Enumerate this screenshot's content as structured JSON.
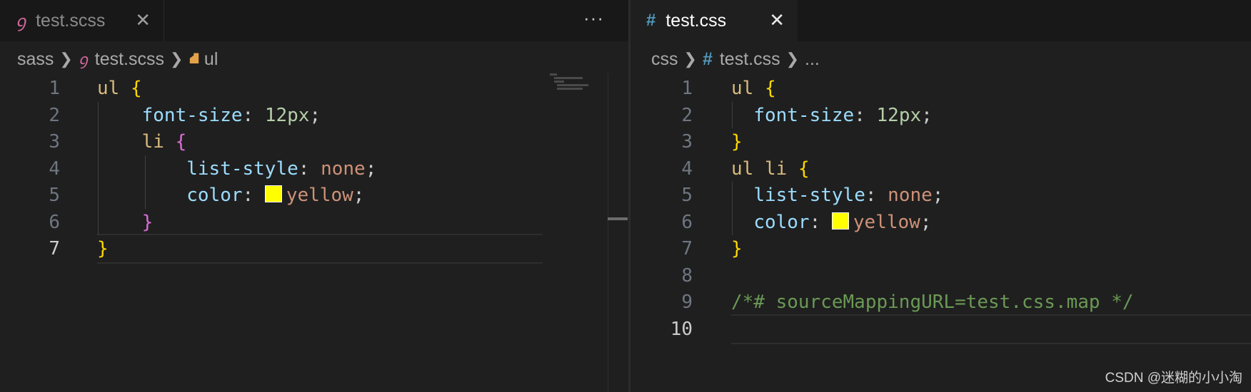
{
  "left_editor": {
    "tab": {
      "icon": "sass-icon",
      "label": "test.scss",
      "close": "✕",
      "more": "···"
    },
    "breadcrumb": {
      "folder": "sass",
      "file": "test.scss",
      "symbol": "ul"
    },
    "lines": [
      {
        "n": "1",
        "tokens": [
          [
            "sel",
            "ul"
          ],
          [
            "pun",
            " "
          ],
          [
            "br1",
            "{"
          ]
        ]
      },
      {
        "n": "2",
        "tokens": [
          [
            "pun",
            "    "
          ],
          [
            "prop",
            "font-size"
          ],
          [
            "pun",
            ": "
          ],
          [
            "num",
            "12px"
          ],
          [
            "pun",
            ";"
          ]
        ]
      },
      {
        "n": "3",
        "tokens": [
          [
            "pun",
            "    "
          ],
          [
            "sel",
            "li"
          ],
          [
            "pun",
            " "
          ],
          [
            "br2",
            "{"
          ]
        ]
      },
      {
        "n": "4",
        "tokens": [
          [
            "pun",
            "        "
          ],
          [
            "prop",
            "list-style"
          ],
          [
            "pun",
            ": "
          ],
          [
            "val",
            "none"
          ],
          [
            "pun",
            ";"
          ]
        ]
      },
      {
        "n": "5",
        "tokens": [
          [
            "pun",
            "        "
          ],
          [
            "prop",
            "color"
          ],
          [
            "pun",
            ": "
          ],
          [
            "swatch",
            ""
          ],
          [
            "val",
            "yellow"
          ],
          [
            "pun",
            ";"
          ]
        ]
      },
      {
        "n": "6",
        "tokens": [
          [
            "pun",
            "    "
          ],
          [
            "br2",
            "}"
          ]
        ]
      },
      {
        "n": "7",
        "tokens": [
          [
            "br1",
            "}"
          ]
        ],
        "active": true
      }
    ]
  },
  "right_editor": {
    "tab": {
      "icon": "css-icon",
      "label": "test.css",
      "close": "✕"
    },
    "breadcrumb": {
      "folder": "css",
      "file": "test.css",
      "symbol": "..."
    },
    "lines": [
      {
        "n": "1",
        "tokens": [
          [
            "sel",
            "ul"
          ],
          [
            "pun",
            " "
          ],
          [
            "br1",
            "{"
          ]
        ]
      },
      {
        "n": "2",
        "tokens": [
          [
            "pun",
            "  "
          ],
          [
            "prop",
            "font-size"
          ],
          [
            "pun",
            ": "
          ],
          [
            "num",
            "12px"
          ],
          [
            "pun",
            ";"
          ]
        ]
      },
      {
        "n": "3",
        "tokens": [
          [
            "br1",
            "}"
          ]
        ]
      },
      {
        "n": "4",
        "tokens": [
          [
            "sel",
            "ul li"
          ],
          [
            "pun",
            " "
          ],
          [
            "br1",
            "{"
          ]
        ]
      },
      {
        "n": "5",
        "tokens": [
          [
            "pun",
            "  "
          ],
          [
            "prop",
            "list-style"
          ],
          [
            "pun",
            ": "
          ],
          [
            "val",
            "none"
          ],
          [
            "pun",
            ";"
          ]
        ]
      },
      {
        "n": "6",
        "tokens": [
          [
            "pun",
            "  "
          ],
          [
            "prop",
            "color"
          ],
          [
            "pun",
            ": "
          ],
          [
            "swatch",
            ""
          ],
          [
            "val",
            "yellow"
          ],
          [
            "pun",
            ";"
          ]
        ]
      },
      {
        "n": "7",
        "tokens": [
          [
            "br1",
            "}"
          ]
        ]
      },
      {
        "n": "8",
        "tokens": []
      },
      {
        "n": "9",
        "tokens": [
          [
            "cmt",
            "/*# sourceMappingURL=test.css.map */"
          ]
        ]
      },
      {
        "n": "10",
        "tokens": [],
        "active": true
      }
    ]
  },
  "watermark": "CSDN @迷糊的小小淘",
  "colors": {
    "swatch": "#ffff00",
    "background": "#1f1f1f"
  }
}
